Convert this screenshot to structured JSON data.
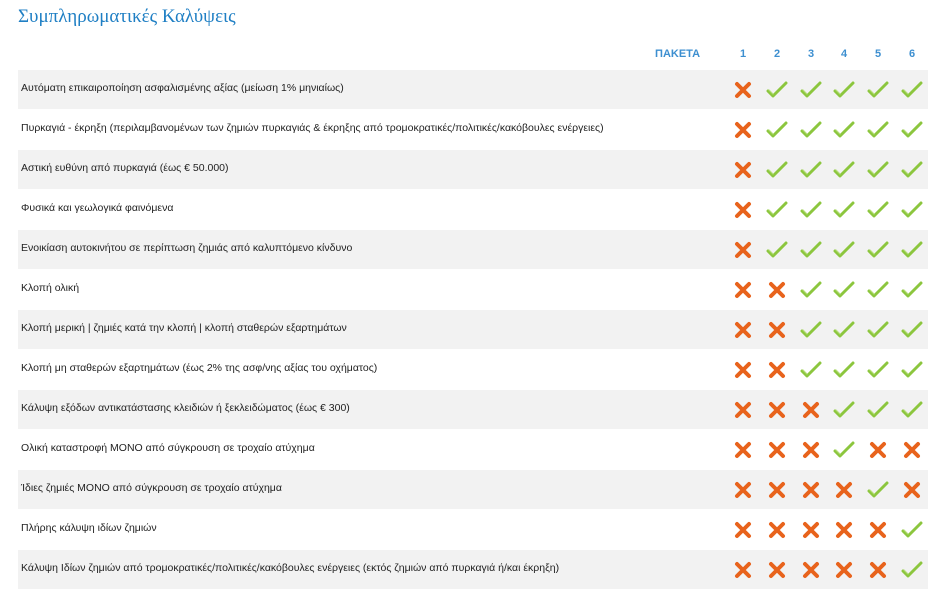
{
  "title": "Συμπληρωματικές Καλύψεις",
  "header": {
    "packages_label": "ΠΑΚΕΤΑ",
    "columns": [
      "1",
      "2",
      "3",
      "4",
      "5",
      "6"
    ]
  },
  "colors": {
    "title": "#1f7fc4",
    "header": "#3d8fd0",
    "check": "#8cc63e",
    "cross": "#e8631c",
    "row_alt": "#f2f2f2"
  },
  "rows": [
    {
      "label": "Αυτόματη επικαιροποίηση ασφαλισμένης αξίας (μείωση 1% μηνιαίως)",
      "cells": [
        "cross-icon",
        "check-icon",
        "check-icon",
        "check-icon",
        "check-icon",
        "check-icon"
      ]
    },
    {
      "label": "Πυρκαγιά - έκρηξη (περιλαμβανομένων των ζημιών πυρκαγιάς & έκρηξης από τρομοκρατικές/πολιτικές/κακόβουλες ενέργειες)",
      "cells": [
        "cross-icon",
        "check-icon",
        "check-icon",
        "check-icon",
        "check-icon",
        "check-icon"
      ]
    },
    {
      "label": "Αστική ευθύνη από πυρκαγιά (έως € 50.000)",
      "cells": [
        "cross-icon",
        "check-icon",
        "check-icon",
        "check-icon",
        "check-icon",
        "check-icon"
      ]
    },
    {
      "label": "Φυσικά και γεωλογικά φαινόμενα",
      "cells": [
        "cross-icon",
        "check-icon",
        "check-icon",
        "check-icon",
        "check-icon",
        "check-icon"
      ]
    },
    {
      "label": "Ενοικίαση αυτοκινήτου σε περίπτωση ζημιάς από καλυπτόμενο κίνδυνο",
      "cells": [
        "cross-icon",
        "check-icon",
        "check-icon",
        "check-icon",
        "check-icon",
        "check-icon"
      ]
    },
    {
      "label": "Κλοπή ολική",
      "cells": [
        "cross-icon",
        "cross-icon",
        "check-icon",
        "check-icon",
        "check-icon",
        "check-icon"
      ]
    },
    {
      "label": "Κλοπή μερική | ζημιές κατά την κλοπή | κλοπή σταθερών εξαρτημάτων",
      "cells": [
        "cross-icon",
        "cross-icon",
        "check-icon",
        "check-icon",
        "check-icon",
        "check-icon"
      ]
    },
    {
      "label": "Κλοπή μη σταθερών εξαρτημάτων (έως 2% της ασφ/νης αξίας του οχήματος)",
      "cells": [
        "cross-icon",
        "cross-icon",
        "check-icon",
        "check-icon",
        "check-icon",
        "check-icon"
      ]
    },
    {
      "label": "Κάλυψη εξόδων αντικατάστασης κλειδιών ή ξεκλειδώματος (έως € 300)",
      "cells": [
        "cross-icon",
        "cross-icon",
        "cross-icon",
        "check-icon",
        "check-icon",
        "check-icon"
      ]
    },
    {
      "label": "Ολική καταστροφή ΜΟΝΟ από σύγκρουση σε τροχαίο ατύχημα",
      "cells": [
        "cross-icon",
        "cross-icon",
        "cross-icon",
        "check-icon",
        "cross-icon",
        "cross-icon"
      ]
    },
    {
      "label": "Ίδιες ζημιές ΜΟΝΟ από σύγκρουση σε τροχαίο ατύχημα",
      "cells": [
        "cross-icon",
        "cross-icon",
        "cross-icon",
        "cross-icon",
        "check-icon",
        "cross-icon"
      ]
    },
    {
      "label": "Πλήρης κάλυψη ιδίων ζημιών",
      "cells": [
        "cross-icon",
        "cross-icon",
        "cross-icon",
        "cross-icon",
        "cross-icon",
        "check-icon"
      ]
    },
    {
      "label": "Κάλυψη Ιδίων ζημιών από τρομοκρατικές/πολιτικές/κακόβουλες ενέργειες (εκτός ζημιών από πυρκαγιά ή/και έκρηξη)",
      "cells": [
        "cross-icon",
        "cross-icon",
        "cross-icon",
        "cross-icon",
        "cross-icon",
        "check-icon"
      ]
    }
  ]
}
